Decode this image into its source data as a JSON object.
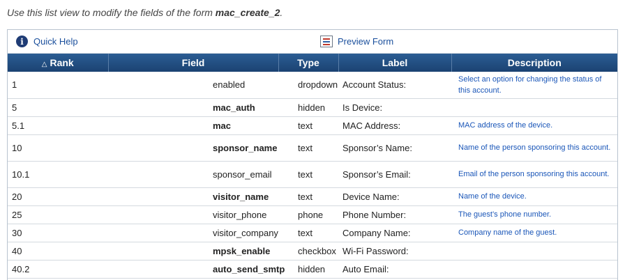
{
  "intro": {
    "prefix": "Use this list view to modify the fields of the form ",
    "form_name": "mac_create_2",
    "suffix": "."
  },
  "toolbar": {
    "help_icon": "info-icon",
    "help_label": "Quick Help",
    "preview_icon": "form-icon",
    "preview_label": "Preview Form"
  },
  "table": {
    "headers": {
      "rank": "Rank",
      "rank_sort_icon": "sort-ascending-icon",
      "field": "Field",
      "type": "Type",
      "label": "Label",
      "description": "Description"
    },
    "rows": [
      {
        "rank": "1",
        "field": "enabled",
        "bold": false,
        "type": "dropdown",
        "label": "Account Status:",
        "description": "Select an option for changing the status of this account."
      },
      {
        "rank": "5",
        "field": "mac_auth",
        "bold": true,
        "type": "hidden",
        "label": "Is Device:",
        "description": ""
      },
      {
        "rank": "5.1",
        "field": "mac",
        "bold": true,
        "type": "text",
        "label": "MAC Address:",
        "description": "MAC address of the device."
      },
      {
        "rank": "10",
        "field": "sponsor_name",
        "bold": true,
        "type": "text",
        "label": "Sponsor’s Name:",
        "description": "Name of the person sponsoring this account."
      },
      {
        "rank": "10.1",
        "field": "sponsor_email",
        "bold": false,
        "type": "text",
        "label": "Sponsor’s Email:",
        "description": "Email of the person sponsoring this account."
      },
      {
        "rank": "20",
        "field": "visitor_name",
        "bold": true,
        "type": "text",
        "label": "Device Name:",
        "description": "Name of the device."
      },
      {
        "rank": "25",
        "field": "visitor_phone",
        "bold": false,
        "type": "phone",
        "label": "Phone Number:",
        "description": "The guest’s phone number."
      },
      {
        "rank": "30",
        "field": "visitor_company",
        "bold": false,
        "type": "text",
        "label": "Company Name:",
        "description": "Company name of the guest."
      },
      {
        "rank": "40",
        "field": "mpsk_enable",
        "bold": true,
        "type": "checkbox",
        "label": "Wi-Fi Password:",
        "description": ""
      },
      {
        "rank": "40.2",
        "field": "auto_send_smtp",
        "bold": true,
        "type": "hidden",
        "label": "Auto Email:",
        "description": ""
      }
    ]
  }
}
